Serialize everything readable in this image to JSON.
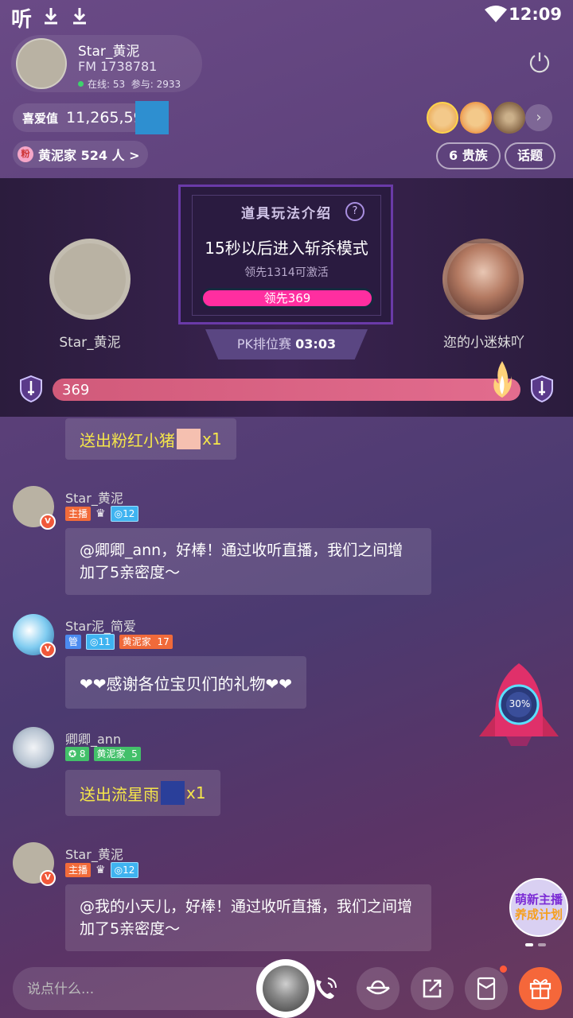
{
  "status_bar": {
    "app_glyph": "听",
    "time": "12:09"
  },
  "host": {
    "name": "Star_黄泥",
    "fm": "FM 1738781",
    "online_label": "在线: 53",
    "join_label": "参与: 2933"
  },
  "likes": {
    "label": "喜爱值",
    "value": "11,265,592"
  },
  "fan_club": {
    "badge": "粉",
    "label": "黄泥家 524 人 >"
  },
  "buttons": {
    "nobles": "6 贵族",
    "topic": "话题"
  },
  "more": "›",
  "pk": {
    "panel_title": "道具玩法介绍",
    "help": "?",
    "main_text": "15秒以后进入斩杀模式",
    "sub_text": "领先1314可激活",
    "lead_label": "领先369",
    "timer_label": "PK排位赛",
    "timer_value": "03:03",
    "left_name": "Star_黄泥",
    "right_name": "迩的小迷妹吖",
    "score": "369"
  },
  "chat": {
    "gift1": {
      "text": "送出粉红小猪",
      "count": "x1"
    },
    "msg1": {
      "user": "Star_黄泥",
      "tag_host": "主播",
      "level": "12",
      "text": "@卿卿_ann，好棒！通过收听直播，我们之间增加了5亲密度～"
    },
    "msg2": {
      "user": "Star泥_简爱",
      "tag_admin": "管",
      "level": "11",
      "club": "黄泥家",
      "club_level": "17",
      "text": "❤❤感谢各位宝贝们的礼物❤❤"
    },
    "msg3": {
      "user": "卿卿_ann",
      "level": "8",
      "club": "黄泥家",
      "club_level": "5",
      "gift_text": "送出流星雨",
      "count": "x1"
    },
    "msg4": {
      "user": "Star_黄泥",
      "tag_host": "主播",
      "level": "12",
      "text": "@我的小天儿，好棒！通过收听直播，我们之间增加了5亲密度～"
    }
  },
  "rocket": {
    "percent": "30%"
  },
  "promo": {
    "line1": "萌新主播",
    "line2": "养成计划"
  },
  "input": {
    "placeholder": "说点什么..."
  },
  "colors": {
    "accent_pink": "#ff2ea0",
    "gift_yellow": "#f5e64a",
    "gift_button": "#f5673a"
  },
  "icons": [
    "download-icon",
    "wifi-icon",
    "power-icon",
    "shield-sword-icon",
    "flame-icon",
    "call-icon",
    "ingot-icon",
    "share-icon",
    "envelope-icon",
    "gift-icon",
    "rocket-icon"
  ]
}
